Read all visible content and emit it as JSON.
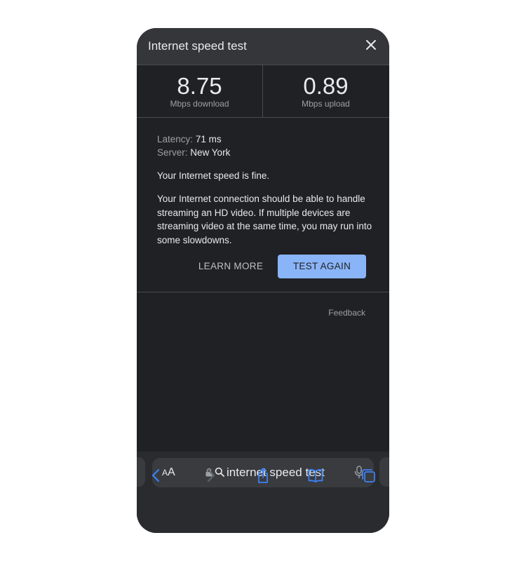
{
  "header": {
    "title": "Internet speed test"
  },
  "results": {
    "download": {
      "value": "8.75",
      "unit": "Mbps download"
    },
    "upload": {
      "value": "0.89",
      "unit": "Mbps upload"
    }
  },
  "details": {
    "latency_label": "Latency:",
    "latency_value": "71 ms",
    "server_label": "Server:",
    "server_value": "New York",
    "summary": "Your Internet speed is fine.",
    "description": "Your Internet connection should be able to handle streaming an HD video. If multiple devices are streaming video at the same time, you may run into some slowdowns."
  },
  "actions": {
    "learn_more": "LEARN MORE",
    "test_again": "TEST AGAIN"
  },
  "feedback_label": "Feedback",
  "browser": {
    "text_size_small": "A",
    "text_size_large": "A",
    "url": "internet speed test",
    "accent": "#3b82f6",
    "icons": [
      "back-icon",
      "forward-icon",
      "share-icon",
      "bookmarks-icon",
      "tabs-icon"
    ]
  }
}
